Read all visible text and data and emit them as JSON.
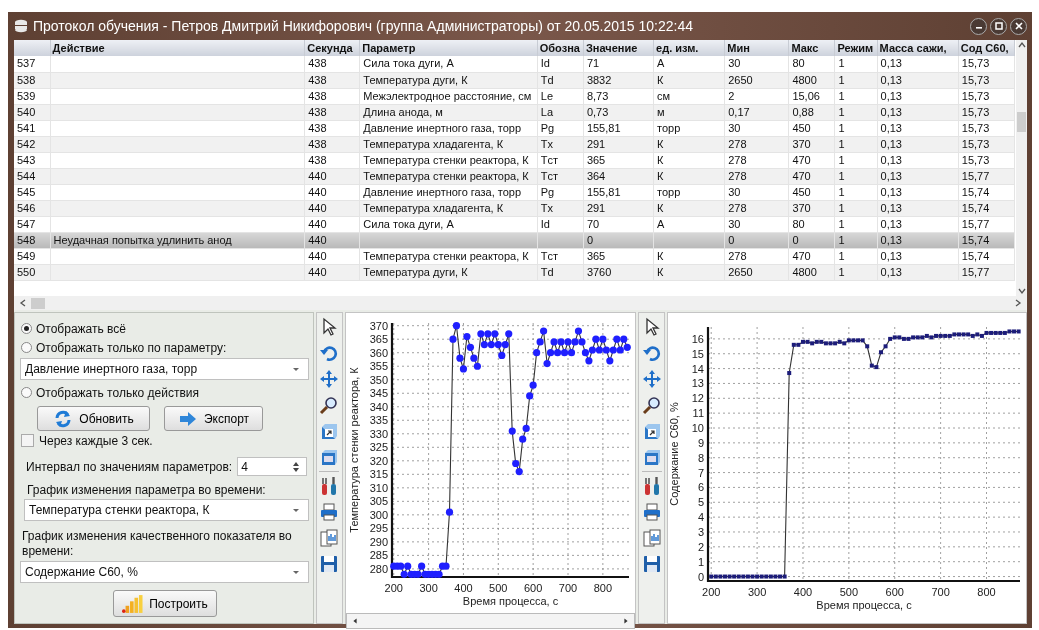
{
  "window": {
    "title": "Протокол обучения - Петров Дмитрий Никифорович (группа Администраторы) от 20.05.2015 10:22:44"
  },
  "table": {
    "columns": [
      "Действие",
      "Секунда",
      "Параметр",
      "Обозна",
      "Значение",
      "ед. изм.",
      "Мин",
      "Макс",
      "Режим",
      "Масса сажи,",
      "Сод С60,"
    ],
    "rows": [
      {
        "n": "537",
        "second": "438",
        "parameter": "Сила тока дуги, А",
        "symbol": "Id",
        "value": "71",
        "unit": "А",
        "min": "30",
        "max": "80",
        "mode": "1",
        "soot_mass": "0,13",
        "c60": "15,73",
        "selected": false
      },
      {
        "n": "538",
        "second": "438",
        "parameter": "Температура дуги, К",
        "symbol": "Td",
        "value": "3832",
        "unit": "К",
        "min": "2650",
        "max": "4800",
        "mode": "1",
        "soot_mass": "0,13",
        "c60": "15,73",
        "selected": false
      },
      {
        "n": "539",
        "second": "438",
        "parameter": "Межэлектродное расстояние, см",
        "symbol": "Le",
        "value": "8,73",
        "unit": "см",
        "min": "2",
        "max": "15,06",
        "mode": "1",
        "soot_mass": "0,13",
        "c60": "15,73",
        "selected": false
      },
      {
        "n": "540",
        "second": "438",
        "parameter": "Длина анода, м",
        "symbol": "La",
        "value": "0,73",
        "unit": "м",
        "min": "0,17",
        "max": "0,88",
        "mode": "1",
        "soot_mass": "0,13",
        "c60": "15,73",
        "selected": false
      },
      {
        "n": "541",
        "second": "438",
        "parameter": "Давление инертного газа, торр",
        "symbol": "Pg",
        "value": "155,81",
        "unit": "торр",
        "min": "30",
        "max": "450",
        "mode": "1",
        "soot_mass": "0,13",
        "c60": "15,73",
        "selected": false
      },
      {
        "n": "542",
        "second": "438",
        "parameter": "Температура хладагента, К",
        "symbol": "Tx",
        "value": "291",
        "unit": "К",
        "min": "278",
        "max": "370",
        "mode": "1",
        "soot_mass": "0,13",
        "c60": "15,73",
        "selected": false
      },
      {
        "n": "543",
        "second": "438",
        "parameter": "Температура стенки реактора, К",
        "symbol": "Tст",
        "value": "365",
        "unit": "К",
        "min": "278",
        "max": "470",
        "mode": "1",
        "soot_mass": "0,13",
        "c60": "15,73",
        "selected": false
      },
      {
        "n": "544",
        "second": "440",
        "parameter": "Температура стенки реактора, К",
        "symbol": "Tст",
        "value": "364",
        "unit": "К",
        "min": "278",
        "max": "470",
        "mode": "1",
        "soot_mass": "0,13",
        "c60": "15,77",
        "selected": false
      },
      {
        "n": "545",
        "second": "440",
        "parameter": "Давление инертного газа, торр",
        "symbol": "Pg",
        "value": "155,81",
        "unit": "торр",
        "min": "30",
        "max": "450",
        "mode": "1",
        "soot_mass": "0,13",
        "c60": "15,74",
        "selected": false
      },
      {
        "n": "546",
        "second": "440",
        "parameter": "Температура хладагента, К",
        "symbol": "Tx",
        "value": "291",
        "unit": "К",
        "min": "278",
        "max": "370",
        "mode": "1",
        "soot_mass": "0,13",
        "c60": "15,74",
        "selected": false
      },
      {
        "n": "547",
        "second": "440",
        "parameter": "Сила тока дуги, А",
        "symbol": "Id",
        "value": "70",
        "unit": "А",
        "min": "30",
        "max": "80",
        "mode": "1",
        "soot_mass": "0,13",
        "c60": "15,77",
        "selected": false
      },
      {
        "n": "548",
        "action": "Неудачная попытка удлинить анод",
        "second": "440",
        "value": "0",
        "min": "0",
        "max": "0",
        "mode": "1",
        "soot_mass": "0,13",
        "c60": "15,74",
        "selected": true
      },
      {
        "n": "549",
        "second": "440",
        "parameter": "Температура стенки реактора, К",
        "symbol": "Tст",
        "value": "365",
        "unit": "К",
        "min": "278",
        "max": "470",
        "mode": "1",
        "soot_mass": "0,13",
        "c60": "15,74",
        "selected": false
      },
      {
        "n": "550",
        "second": "440",
        "parameter": "Температура дуги, К",
        "symbol": "Td",
        "value": "3760",
        "unit": "К",
        "min": "2650",
        "max": "4800",
        "mode": "1",
        "soot_mass": "0,13",
        "c60": "15,77",
        "selected": false
      }
    ]
  },
  "filter_options": [
    {
      "label": "Отображать всё",
      "selected": true
    },
    {
      "label": "Отображать только по параметру:",
      "selected": false
    },
    {
      "label": "Отображать только действия",
      "selected": false
    }
  ],
  "parameter_filter": {
    "value": "Давление инертного газа, торр"
  },
  "refresh_button": "Обновить",
  "export_button": "Экспорт",
  "auto_refresh": {
    "label": "Через каждые 3 сек.",
    "checked": false
  },
  "interval": {
    "label": "Интервал по значениям параметров:",
    "value": "4"
  },
  "parameter_chart": {
    "label": "График изменения параметра во времени:",
    "value": "Температура стенки реактора, К"
  },
  "quality_chart": {
    "label": "График изменения качественного показателя во времени:",
    "value": "Содержание С60, %"
  },
  "build_button": "Построить",
  "charts": [
    {
      "chart_data": {
        "type": "line",
        "grid": true,
        "xlabel": "Время процесса, с",
        "ylabel": "Температура стенки реактора, К",
        "xlim": [
          195,
          875
        ],
        "ylim": [
          277,
          371
        ],
        "xticks": [
          200,
          300,
          400,
          500,
          600,
          700,
          800
        ],
        "yticks": [
          280,
          285,
          290,
          295,
          300,
          305,
          310,
          315,
          320,
          325,
          330,
          335,
          340,
          345,
          350,
          355,
          360,
          365,
          370
        ],
        "x": [
          200,
          210,
          220,
          230,
          240,
          250,
          260,
          270,
          280,
          290,
          300,
          310,
          320,
          330,
          340,
          350,
          360,
          370,
          380,
          390,
          400,
          410,
          420,
          430,
          440,
          450,
          460,
          470,
          480,
          490,
          500,
          510,
          520,
          530,
          540,
          550,
          560,
          570,
          580,
          590,
          600,
          610,
          620,
          630,
          640,
          650,
          660,
          670,
          680,
          690,
          700,
          710,
          720,
          730,
          740,
          750,
          760,
          770,
          780,
          790,
          800,
          810,
          820,
          830,
          840,
          850,
          860,
          870
        ],
        "series": [
          {
            "color": "#1f1fff",
            "marker": "circle",
            "values": [
              281,
              281,
              281,
              278,
              281,
              278,
              278,
              278,
              281,
              278,
              278,
              278,
              278,
              278,
              281,
              281,
              301,
              365,
              370,
              358,
              354,
              366,
              362,
              358,
              355,
              367,
              363,
              367,
              363,
              367,
              363,
              359,
              363,
              367,
              331,
              319,
              316,
              328,
              332,
              344,
              348,
              360,
              364,
              368,
              356,
              360,
              364,
              360,
              364,
              360,
              364,
              360,
              364,
              368,
              364,
              360,
              357,
              361,
              365,
              361,
              365,
              361,
              357,
              361,
              365,
              361,
              365,
              362
            ]
          }
        ]
      }
    },
    {
      "chart_data": {
        "type": "line",
        "grid": true,
        "xlabel": "Время процесса, с",
        "ylabel": "Содержание С60, %",
        "xlim": [
          193,
          873
        ],
        "ylim": [
          -0.3,
          16.8
        ],
        "xticks": [
          200,
          300,
          400,
          500,
          600,
          700,
          800
        ],
        "yticks": [
          0,
          1,
          2,
          3,
          4,
          5,
          6,
          7,
          8,
          9,
          10,
          11,
          12,
          13,
          14,
          15,
          16
        ],
        "x": [
          200,
          210,
          220,
          230,
          240,
          250,
          260,
          270,
          280,
          290,
          300,
          310,
          320,
          330,
          340,
          350,
          360,
          370,
          380,
          390,
          400,
          410,
          420,
          430,
          440,
          450,
          460,
          470,
          480,
          490,
          500,
          510,
          520,
          530,
          540,
          550,
          560,
          570,
          580,
          590,
          600,
          610,
          620,
          630,
          640,
          650,
          660,
          670,
          680,
          690,
          700,
          710,
          720,
          730,
          740,
          750,
          760,
          770,
          780,
          790,
          800,
          810,
          820,
          830,
          840,
          850,
          860,
          870
        ],
        "series": [
          {
            "color": "#1c1c7a",
            "marker": "square",
            "values": [
              0,
              0,
              0,
              0,
              0,
              0,
              0,
              0,
              0,
              0,
              0,
              0,
              0,
              0,
              0,
              0,
              0,
              13.7,
              15.6,
              15.6,
              15.8,
              15.8,
              15.7,
              15.8,
              15.8,
              15.7,
              15.7,
              15.7,
              15.8,
              15.7,
              15.9,
              15.9,
              15.9,
              15.9,
              15.5,
              14.2,
              14.1,
              15.1,
              15.5,
              16,
              16.1,
              16.1,
              16,
              16,
              16.1,
              16.1,
              16.1,
              16.2,
              16.1,
              16.2,
              16.2,
              16.2,
              16.2,
              16.3,
              16.3,
              16.3,
              16.3,
              16.2,
              16.3,
              16.2,
              16.4,
              16.4,
              16.4,
              16.4,
              16.4,
              16.5,
              16.5,
              16.5
            ]
          }
        ]
      }
    }
  ]
}
